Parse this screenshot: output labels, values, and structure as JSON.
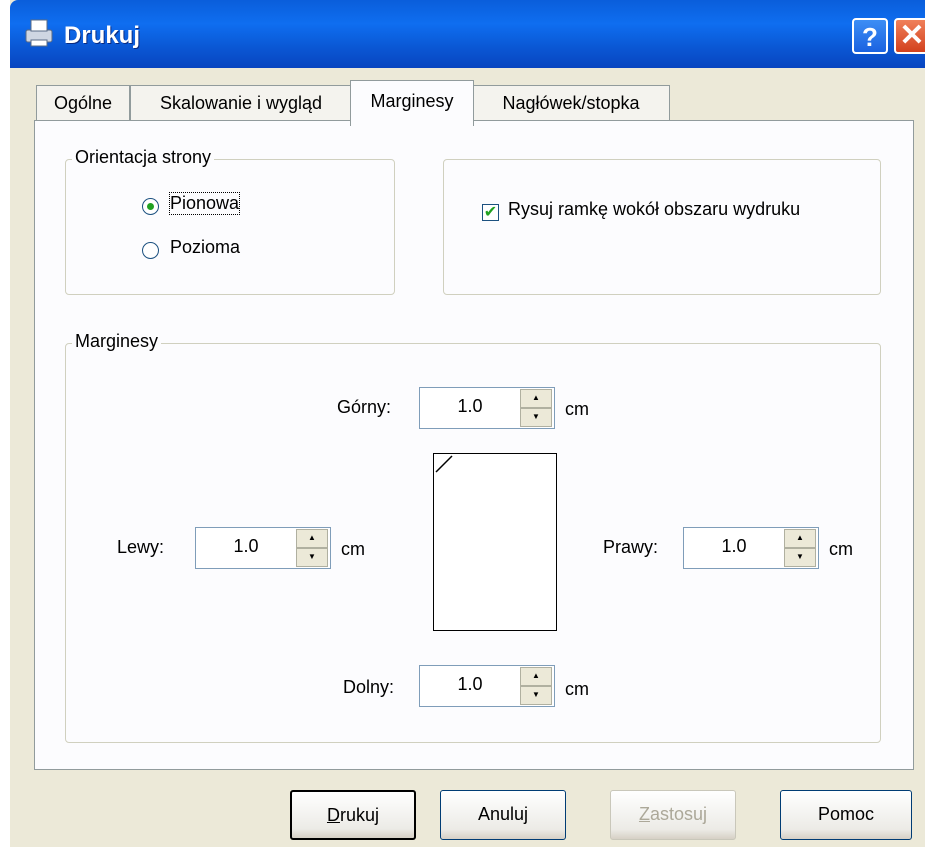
{
  "window": {
    "title": "Drukuj"
  },
  "tabs": [
    "Ogólne",
    "Skalowanie i wygląd",
    "Marginesy",
    "Nagłówek/stopka"
  ],
  "active_tab": "Marginesy",
  "orientation": {
    "legend": "Orientacja strony",
    "options": [
      "Pionowa",
      "Pozioma"
    ],
    "selected": "Pionowa"
  },
  "frame_option": {
    "label": "Rysuj ramkę wokół obszaru wydruku",
    "checked": true
  },
  "margins": {
    "legend": "Marginesy",
    "unit": "cm",
    "top": {
      "label": "Górny:",
      "value": "1.0"
    },
    "left": {
      "label": "Lewy:",
      "value": "1.0"
    },
    "right": {
      "label": "Prawy:",
      "value": "1.0"
    },
    "bottom": {
      "label": "Dolny:",
      "value": "1.0"
    }
  },
  "buttons": {
    "print": {
      "mnemonic": "D",
      "rest": "rukuj"
    },
    "cancel": "Anuluj",
    "apply": {
      "mnemonic": "Z",
      "rest": "astosuj"
    },
    "help": "Pomoc"
  }
}
